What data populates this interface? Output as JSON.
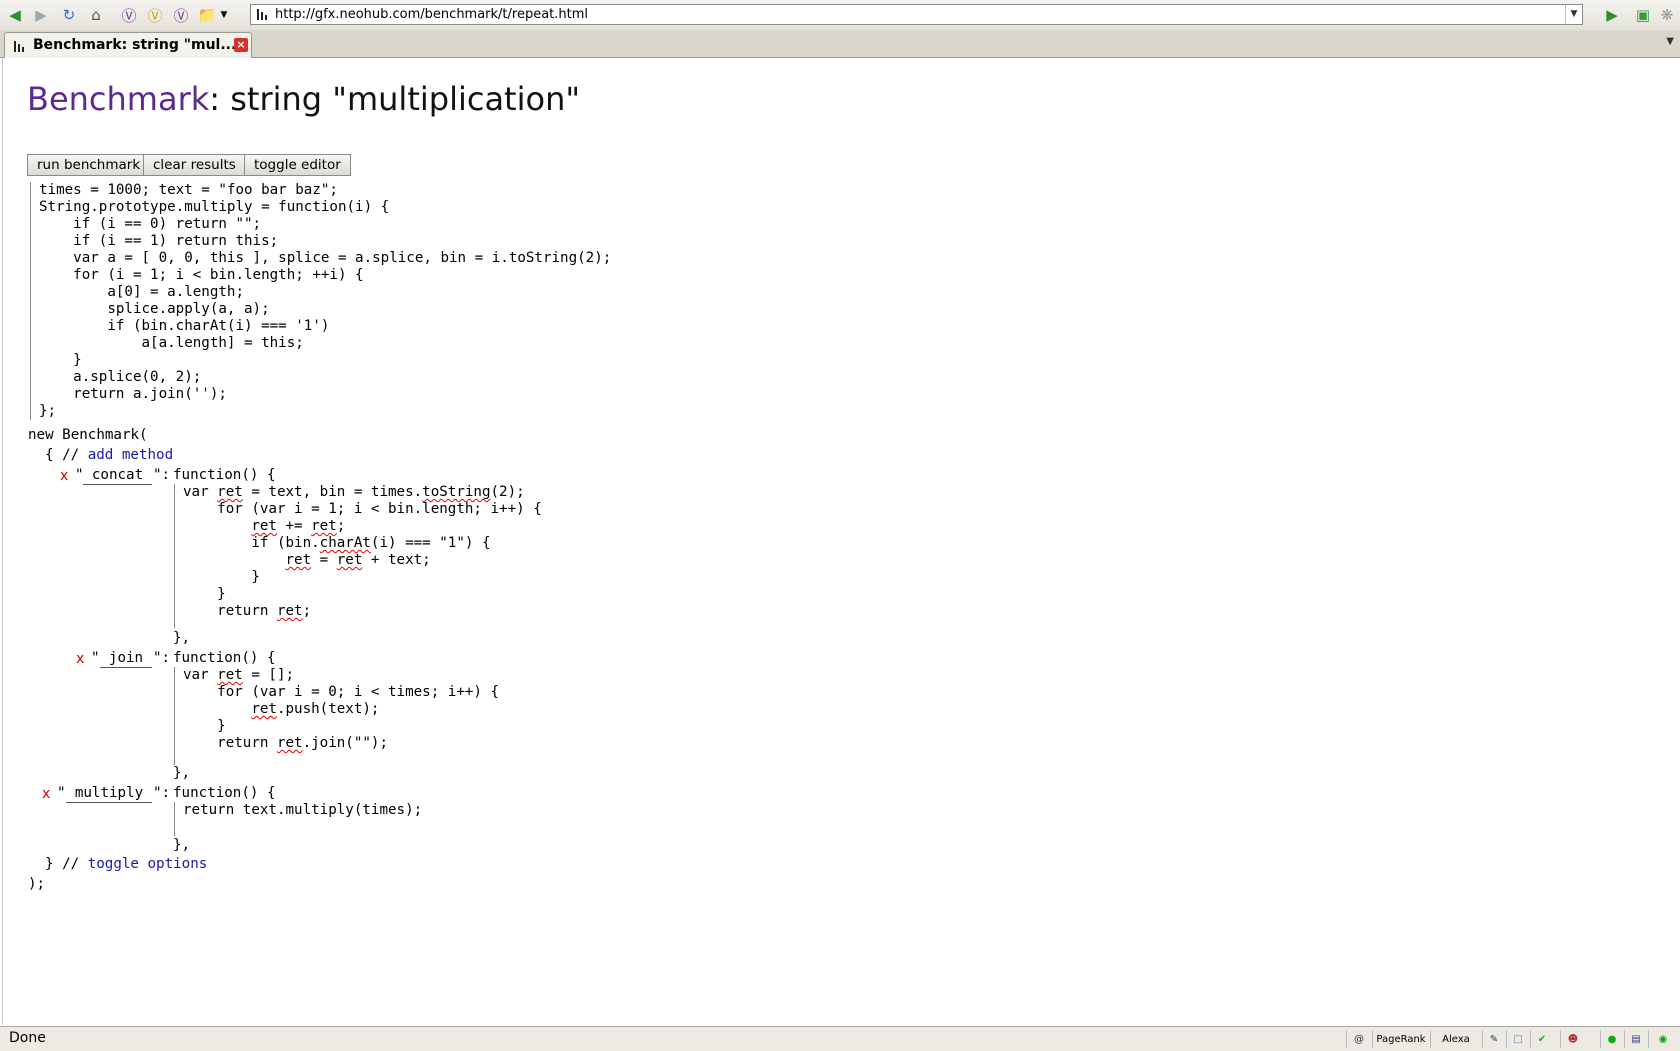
{
  "browser": {
    "url": "http://gfx.neohub.com/benchmark/t/repeat.html",
    "tab_title": "Benchmark: string \"mul...",
    "status": "Done",
    "status_items": [
      "PageRank",
      "Alexa"
    ]
  },
  "page": {
    "heading_brand": "Benchmark",
    "heading_rest": ": string \"multiplication\"",
    "buttons": {
      "run": "run benchmark",
      "clear": "clear results",
      "toggle": "toggle editor"
    },
    "setup_code": "times = 1000; text = \"foo bar baz\";\nString.prototype.multiply = function(i) {\n    if (i == 0) return \"\";\n    if (i == 1) return this;\n    var a = [ 0, 0, this ], splice = a.splice, bin = i.toString(2);\n    for (i = 1; i < bin.length; ++i) {\n        a[0] = a.length;\n        splice.apply(a, a);\n        if (bin.charAt(i) === '1')\n            a[a.length] = this;\n    }\n    a.splice(0, 2);\n    return a.join('');\n};",
    "new_benchmark": "new Benchmark(",
    "open_brace": "{ //",
    "add_method": "add method",
    "close_brace": "} //",
    "toggle_options": "toggle options",
    "end": ");",
    "methods": [
      {
        "name": "concat",
        "body": "var ret = text, bin = times.toString(2);\n    for (var i = 1; i < bin.length; i++) {\n        ret += ret;\n        if (bin.charAt(i) === \"1\") {\n            ret = ret + text;\n        }\n    }\n    return ret;\n"
      },
      {
        "name": "join",
        "body": "var ret = [];\n    for (var i = 0; i < times; i++) {\n        ret.push(text);\n    }\n    return ret.join(\"\");\n"
      },
      {
        "name": "multiply",
        "body": "return text.multiply(times);\n"
      }
    ],
    "delete_mark": "x",
    "quote_open": "\"",
    "quote_close": "\":",
    "function_head": "function() {",
    "function_end": "},"
  }
}
